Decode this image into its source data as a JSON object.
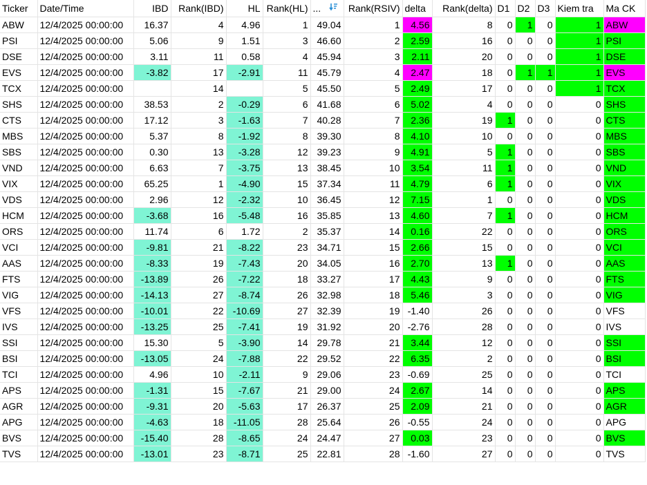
{
  "colors": {
    "teal": "#7ff4d4",
    "green": "#00ff00",
    "magenta": "#ff00ff"
  },
  "headers": {
    "ticker": "Ticker",
    "datetime": "Date/Time",
    "ibd": "IBD",
    "rank_ibd": "Rank(IBD)",
    "hl": "HL",
    "rank_hl": "Rank(HL)",
    "rsiv_truncated": "...",
    "sort_icon": "sort-descending-icon",
    "rank_rsiv": "Rank(RSIV)",
    "delta": "delta",
    "rank_delta": "Rank(delta)",
    "d1": "D1",
    "d2": "D2",
    "d3": "D3",
    "kiem_tra": "Kiem tra",
    "ma_ck": "Ma CK"
  },
  "rows": [
    {
      "ticker": "ABW",
      "date": "12/4/2025 00:00:00",
      "ibd": "16.37",
      "rank_ibd": "4",
      "hl": "4.96",
      "rank_hl": "1",
      "rsiv": "49.04",
      "rank_rsiv": "1",
      "delta": "4.56",
      "rank_delta": "8",
      "d1": "0",
      "d2": "1",
      "d3": "0",
      "kiem_tra": "1",
      "ma_ck": "ABW"
    },
    {
      "ticker": "PSI",
      "date": "12/4/2025 00:00:00",
      "ibd": "5.06",
      "rank_ibd": "9",
      "hl": "1.51",
      "rank_hl": "3",
      "rsiv": "46.60",
      "rank_rsiv": "2",
      "delta": "2.59",
      "rank_delta": "16",
      "d1": "0",
      "d2": "0",
      "d3": "0",
      "kiem_tra": "1",
      "ma_ck": "PSI"
    },
    {
      "ticker": "DSE",
      "date": "12/4/2025 00:00:00",
      "ibd": "3.11",
      "rank_ibd": "11",
      "hl": "0.58",
      "rank_hl": "4",
      "rsiv": "45.94",
      "rank_rsiv": "3",
      "delta": "2.11",
      "rank_delta": "20",
      "d1": "0",
      "d2": "0",
      "d3": "0",
      "kiem_tra": "1",
      "ma_ck": "DSE"
    },
    {
      "ticker": "EVS",
      "date": "12/4/2025 00:00:00",
      "ibd": "-3.82",
      "rank_ibd": "17",
      "hl": "-2.91",
      "rank_hl": "11",
      "rsiv": "45.79",
      "rank_rsiv": "4",
      "delta": "2.47",
      "rank_delta": "18",
      "d1": "0",
      "d2": "1",
      "d3": "1",
      "kiem_tra": "1",
      "ma_ck": "EVS"
    },
    {
      "ticker": "TCX",
      "date": "12/4/2025 00:00:00",
      "ibd": "",
      "rank_ibd": "14",
      "hl": "",
      "rank_hl": "5",
      "rsiv": "45.50",
      "rank_rsiv": "5",
      "delta": "2.49",
      "rank_delta": "17",
      "d1": "0",
      "d2": "0",
      "d3": "0",
      "kiem_tra": "1",
      "ma_ck": "TCX"
    },
    {
      "ticker": "SHS",
      "date": "12/4/2025 00:00:00",
      "ibd": "38.53",
      "rank_ibd": "2",
      "hl": "-0.29",
      "rank_hl": "6",
      "rsiv": "41.68",
      "rank_rsiv": "6",
      "delta": "5.02",
      "rank_delta": "4",
      "d1": "0",
      "d2": "0",
      "d3": "0",
      "kiem_tra": "0",
      "ma_ck": "SHS"
    },
    {
      "ticker": "CTS",
      "date": "12/4/2025 00:00:00",
      "ibd": "17.12",
      "rank_ibd": "3",
      "hl": "-1.63",
      "rank_hl": "7",
      "rsiv": "40.28",
      "rank_rsiv": "7",
      "delta": "2.36",
      "rank_delta": "19",
      "d1": "1",
      "d2": "0",
      "d3": "0",
      "kiem_tra": "0",
      "ma_ck": "CTS"
    },
    {
      "ticker": "MBS",
      "date": "12/4/2025 00:00:00",
      "ibd": "5.37",
      "rank_ibd": "8",
      "hl": "-1.92",
      "rank_hl": "8",
      "rsiv": "39.30",
      "rank_rsiv": "8",
      "delta": "4.10",
      "rank_delta": "10",
      "d1": "0",
      "d2": "0",
      "d3": "0",
      "kiem_tra": "0",
      "ma_ck": "MBS"
    },
    {
      "ticker": "SBS",
      "date": "12/4/2025 00:00:00",
      "ibd": "0.30",
      "rank_ibd": "13",
      "hl": "-3.28",
      "rank_hl": "12",
      "rsiv": "39.23",
      "rank_rsiv": "9",
      "delta": "4.91",
      "rank_delta": "5",
      "d1": "1",
      "d2": "0",
      "d3": "0",
      "kiem_tra": "0",
      "ma_ck": "SBS"
    },
    {
      "ticker": "VND",
      "date": "12/4/2025 00:00:00",
      "ibd": "6.63",
      "rank_ibd": "7",
      "hl": "-3.75",
      "rank_hl": "13",
      "rsiv": "38.45",
      "rank_rsiv": "10",
      "delta": "3.54",
      "rank_delta": "11",
      "d1": "1",
      "d2": "0",
      "d3": "0",
      "kiem_tra": "0",
      "ma_ck": "VND"
    },
    {
      "ticker": "VIX",
      "date": "12/4/2025 00:00:00",
      "ibd": "65.25",
      "rank_ibd": "1",
      "hl": "-4.90",
      "rank_hl": "15",
      "rsiv": "37.34",
      "rank_rsiv": "11",
      "delta": "4.79",
      "rank_delta": "6",
      "d1": "1",
      "d2": "0",
      "d3": "0",
      "kiem_tra": "0",
      "ma_ck": "VIX"
    },
    {
      "ticker": "VDS",
      "date": "12/4/2025 00:00:00",
      "ibd": "2.96",
      "rank_ibd": "12",
      "hl": "-2.32",
      "rank_hl": "10",
      "rsiv": "36.45",
      "rank_rsiv": "12",
      "delta": "7.15",
      "rank_delta": "1",
      "d1": "0",
      "d2": "0",
      "d3": "0",
      "kiem_tra": "0",
      "ma_ck": "VDS"
    },
    {
      "ticker": "HCM",
      "date": "12/4/2025 00:00:00",
      "ibd": "-3.68",
      "rank_ibd": "16",
      "hl": "-5.48",
      "rank_hl": "16",
      "rsiv": "35.85",
      "rank_rsiv": "13",
      "delta": "4.60",
      "rank_delta": "7",
      "d1": "1",
      "d2": "0",
      "d3": "0",
      "kiem_tra": "0",
      "ma_ck": "HCM"
    },
    {
      "ticker": "ORS",
      "date": "12/4/2025 00:00:00",
      "ibd": "11.74",
      "rank_ibd": "6",
      "hl": "1.72",
      "rank_hl": "2",
      "rsiv": "35.37",
      "rank_rsiv": "14",
      "delta": "0.16",
      "rank_delta": "22",
      "d1": "0",
      "d2": "0",
      "d3": "0",
      "kiem_tra": "0",
      "ma_ck": "ORS"
    },
    {
      "ticker": "VCI",
      "date": "12/4/2025 00:00:00",
      "ibd": "-9.81",
      "rank_ibd": "21",
      "hl": "-8.22",
      "rank_hl": "23",
      "rsiv": "34.71",
      "rank_rsiv": "15",
      "delta": "2.66",
      "rank_delta": "15",
      "d1": "0",
      "d2": "0",
      "d3": "0",
      "kiem_tra": "0",
      "ma_ck": "VCI"
    },
    {
      "ticker": "AAS",
      "date": "12/4/2025 00:00:00",
      "ibd": "-8.33",
      "rank_ibd": "19",
      "hl": "-7.43",
      "rank_hl": "20",
      "rsiv": "34.05",
      "rank_rsiv": "16",
      "delta": "2.70",
      "rank_delta": "13",
      "d1": "1",
      "d2": "0",
      "d3": "0",
      "kiem_tra": "0",
      "ma_ck": "AAS"
    },
    {
      "ticker": "FTS",
      "date": "12/4/2025 00:00:00",
      "ibd": "-13.89",
      "rank_ibd": "26",
      "hl": "-7.22",
      "rank_hl": "18",
      "rsiv": "33.27",
      "rank_rsiv": "17",
      "delta": "4.43",
      "rank_delta": "9",
      "d1": "0",
      "d2": "0",
      "d3": "0",
      "kiem_tra": "0",
      "ma_ck": "FTS"
    },
    {
      "ticker": "VIG",
      "date": "12/4/2025 00:00:00",
      "ibd": "-14.13",
      "rank_ibd": "27",
      "hl": "-8.74",
      "rank_hl": "26",
      "rsiv": "32.98",
      "rank_rsiv": "18",
      "delta": "5.46",
      "rank_delta": "3",
      "d1": "0",
      "d2": "0",
      "d3": "0",
      "kiem_tra": "0",
      "ma_ck": "VIG"
    },
    {
      "ticker": "VFS",
      "date": "12/4/2025 00:00:00",
      "ibd": "-10.01",
      "rank_ibd": "22",
      "hl": "-10.69",
      "rank_hl": "27",
      "rsiv": "32.39",
      "rank_rsiv": "19",
      "delta": "-1.40",
      "rank_delta": "26",
      "d1": "0",
      "d2": "0",
      "d3": "0",
      "kiem_tra": "0",
      "ma_ck": "VFS"
    },
    {
      "ticker": "IVS",
      "date": "12/4/2025 00:00:00",
      "ibd": "-13.25",
      "rank_ibd": "25",
      "hl": "-7.41",
      "rank_hl": "19",
      "rsiv": "31.92",
      "rank_rsiv": "20",
      "delta": "-2.76",
      "rank_delta": "28",
      "d1": "0",
      "d2": "0",
      "d3": "0",
      "kiem_tra": "0",
      "ma_ck": "IVS"
    },
    {
      "ticker": "SSI",
      "date": "12/4/2025 00:00:00",
      "ibd": "15.30",
      "rank_ibd": "5",
      "hl": "-3.90",
      "rank_hl": "14",
      "rsiv": "29.78",
      "rank_rsiv": "21",
      "delta": "3.44",
      "rank_delta": "12",
      "d1": "0",
      "d2": "0",
      "d3": "0",
      "kiem_tra": "0",
      "ma_ck": "SSI"
    },
    {
      "ticker": "BSI",
      "date": "12/4/2025 00:00:00",
      "ibd": "-13.05",
      "rank_ibd": "24",
      "hl": "-7.88",
      "rank_hl": "22",
      "rsiv": "29.52",
      "rank_rsiv": "22",
      "delta": "6.35",
      "rank_delta": "2",
      "d1": "0",
      "d2": "0",
      "d3": "0",
      "kiem_tra": "0",
      "ma_ck": "BSI"
    },
    {
      "ticker": "TCI",
      "date": "12/4/2025 00:00:00",
      "ibd": "4.96",
      "rank_ibd": "10",
      "hl": "-2.11",
      "rank_hl": "9",
      "rsiv": "29.06",
      "rank_rsiv": "23",
      "delta": "-0.69",
      "rank_delta": "25",
      "d1": "0",
      "d2": "0",
      "d3": "0",
      "kiem_tra": "0",
      "ma_ck": "TCI"
    },
    {
      "ticker": "APS",
      "date": "12/4/2025 00:00:00",
      "ibd": "-1.31",
      "rank_ibd": "15",
      "hl": "-7.67",
      "rank_hl": "21",
      "rsiv": "29.00",
      "rank_rsiv": "24",
      "delta": "2.67",
      "rank_delta": "14",
      "d1": "0",
      "d2": "0",
      "d3": "0",
      "kiem_tra": "0",
      "ma_ck": "APS"
    },
    {
      "ticker": "AGR",
      "date": "12/4/2025 00:00:00",
      "ibd": "-9.31",
      "rank_ibd": "20",
      "hl": "-5.63",
      "rank_hl": "17",
      "rsiv": "26.37",
      "rank_rsiv": "25",
      "delta": "2.09",
      "rank_delta": "21",
      "d1": "0",
      "d2": "0",
      "d3": "0",
      "kiem_tra": "0",
      "ma_ck": "AGR"
    },
    {
      "ticker": "APG",
      "date": "12/4/2025 00:00:00",
      "ibd": "-4.63",
      "rank_ibd": "18",
      "hl": "-11.05",
      "rank_hl": "28",
      "rsiv": "25.64",
      "rank_rsiv": "26",
      "delta": "-0.55",
      "rank_delta": "24",
      "d1": "0",
      "d2": "0",
      "d3": "0",
      "kiem_tra": "0",
      "ma_ck": "APG"
    },
    {
      "ticker": "BVS",
      "date": "12/4/2025 00:00:00",
      "ibd": "-15.40",
      "rank_ibd": "28",
      "hl": "-8.65",
      "rank_hl": "24",
      "rsiv": "24.47",
      "rank_rsiv": "27",
      "delta": "0.03",
      "rank_delta": "23",
      "d1": "0",
      "d2": "0",
      "d3": "0",
      "kiem_tra": "0",
      "ma_ck": "BVS"
    },
    {
      "ticker": "TVS",
      "date": "12/4/2025 00:00:00",
      "ibd": "-13.01",
      "rank_ibd": "23",
      "hl": "-8.71",
      "rank_hl": "25",
      "rsiv": "22.81",
      "rank_rsiv": "28",
      "delta": "-1.60",
      "rank_delta": "27",
      "d1": "0",
      "d2": "0",
      "d3": "0",
      "kiem_tra": "0",
      "ma_ck": "TVS"
    }
  ]
}
